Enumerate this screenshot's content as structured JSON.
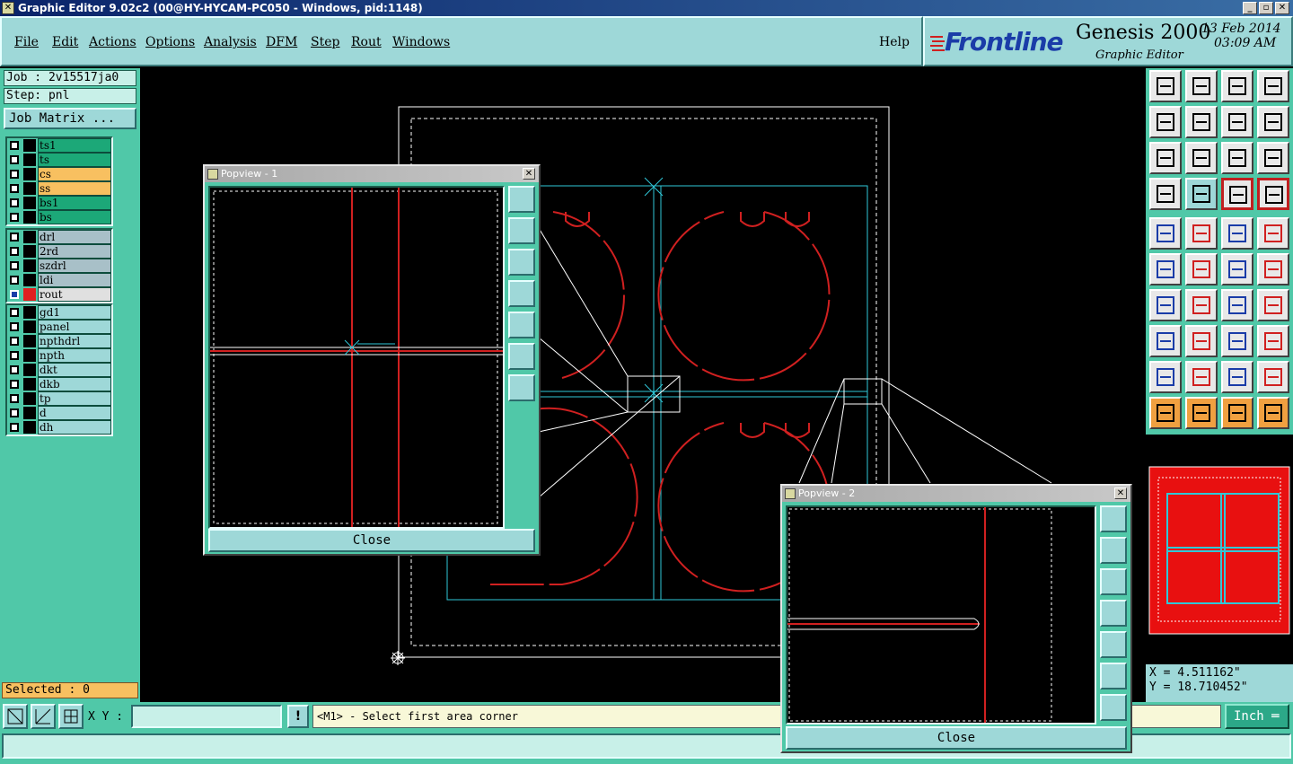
{
  "window": {
    "title": "Graphic Editor 9.02c2 (00@HY-HYCAM-PC050 - Windows, pid:1148)",
    "minimize": "_",
    "restore": "▫",
    "close": "✕"
  },
  "menu": {
    "items": [
      "File",
      "Edit",
      "Actions",
      "Options",
      "Analysis",
      "DFM",
      "Step",
      "Rout",
      "Windows"
    ],
    "help": "Help"
  },
  "brand": {
    "logo": "Frontline",
    "product": "Genesis 2000",
    "subtitle": "Graphic Editor",
    "date": "13 Feb 2014",
    "time": "03:09 AM"
  },
  "job": {
    "job_label": "Job : 2v15517ja0",
    "step_label": "Step: pnl",
    "job_matrix": "Job Matrix ..."
  },
  "layers": {
    "group1": [
      {
        "name": "ts1",
        "color": "#1ca878"
      },
      {
        "name": "ts",
        "color": "#1ca878"
      },
      {
        "name": "cs",
        "color": "#f8c060"
      },
      {
        "name": "ss",
        "color": "#f8c060"
      },
      {
        "name": "bs1",
        "color": "#1ca878"
      },
      {
        "name": "bs",
        "color": "#1ca878"
      }
    ],
    "group2": [
      {
        "name": "drl",
        "color": "#a8c0c8"
      },
      {
        "name": "2rd",
        "color": "#a8c0c8"
      },
      {
        "name": "szdrl",
        "color": "#a8c0c8"
      },
      {
        "name": "ldi",
        "color": "#a8c0c8"
      },
      {
        "name": "rout",
        "color": "#e0e0e0"
      }
    ],
    "group3": [
      {
        "name": "gd1",
        "color": "#9ed8d8"
      },
      {
        "name": "panel",
        "color": "#9ed8d8"
      },
      {
        "name": "npthdrl",
        "color": "#9ed8d8"
      },
      {
        "name": "npth",
        "color": "#9ed8d8"
      },
      {
        "name": "dkt",
        "color": "#9ed8d8"
      },
      {
        "name": "dkb",
        "color": "#9ed8d8"
      },
      {
        "name": "tp",
        "color": "#9ed8d8"
      },
      {
        "name": "d",
        "color": "#9ed8d8"
      },
      {
        "name": "dh",
        "color": "#9ed8d8"
      }
    ],
    "active_layer": "rout",
    "active_swatch": "#e02020"
  },
  "selected": "Selected : 0",
  "coords": {
    "x": "X = 4.511162\"",
    "y": "Y = 18.710452\""
  },
  "bottom": {
    "xy_label": "X Y :",
    "xy_value": "",
    "bang": "!",
    "prompt": "<M1> - Select first area corner",
    "unit": "Inch ═"
  },
  "popview1": {
    "title": "Popview - 1",
    "close": "Close",
    "close_x": "✕"
  },
  "popview2": {
    "title": "Popview - 2",
    "close": "Close",
    "close_x": "✕"
  },
  "colors": {
    "rout": "#d02020",
    "profile": "#30c8d8",
    "outline": "#ffffff",
    "panel_bg": "#50c8a8",
    "accent": "#9ed8d8"
  },
  "tools": {
    "icons": [
      "zoom-home-icon",
      "pan-down-icon",
      "home-icon",
      "split-view-icon",
      "pan-left-icon",
      "pan-right-icon",
      "undo-icon",
      "redo-icon",
      "fit-icon",
      "zoom-fit-icon",
      "scale-1-2-icon",
      "help-icon",
      "snap-icon",
      "grid-icon",
      "layers-icon",
      "layers-alt-icon",
      "feature-select-icon",
      "line-draw-icon",
      "measure-icon",
      "pad-icon",
      "connect-icon",
      "cross-icon",
      "point-icon",
      "point-alt-icon",
      "angle-icon",
      "slash-icon",
      "arc-icon",
      "text-icon",
      "move-icon",
      "minus-icon",
      "center-icon",
      "copy-icon",
      "tri-icon",
      "tri-alt-icon",
      "tri-fill-icon",
      "tri-line-icon",
      "arrow-icon",
      "arrow-box-icon",
      "arrow-alt-icon",
      "route-icon"
    ]
  }
}
